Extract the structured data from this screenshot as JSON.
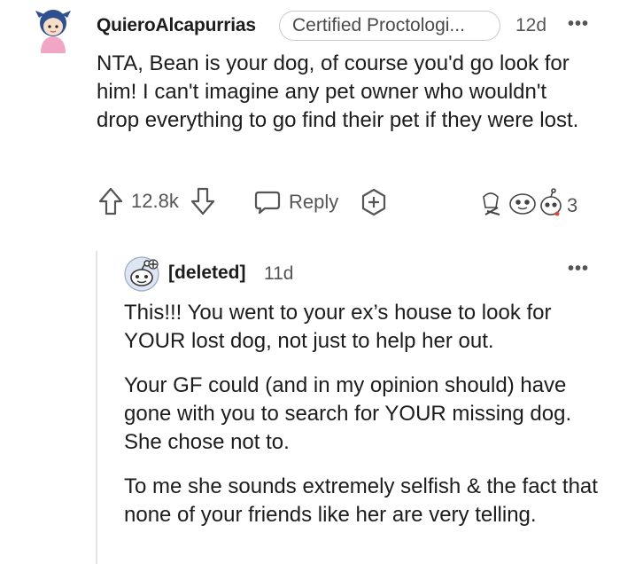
{
  "comment": {
    "username": "QuieroAlcapurrias",
    "flair": "Certified Proctologi...",
    "time": "12d",
    "more_label": "•••",
    "body": "NTA, Bean is your dog, of course you'd go look for him! I can't imagine any pet owner who wouldn't drop everything to go find their pet if they were lost.",
    "upvotes": "12.8k",
    "reply_label": "Reply",
    "award_count": "3"
  },
  "reply": {
    "username": "[deleted]",
    "time": "11d",
    "more_label": "•••",
    "paragraphs": [
      "This!!! You went to your ex’s house to look for YOUR lost dog, not just to help her out.",
      "Your GF could (and in my opinion should) have gone with you to search for YOUR missing dog. She chose not to.",
      "To me she sounds extremely selfish & the fact that none of your friends like her are very telling."
    ]
  },
  "colors": {
    "text": "#1c1c1c",
    "meta": "#555555",
    "thread_line": "#e3e3e3",
    "avatar_hair": "#2f4f8f",
    "avatar_shirt": "#f2a6c6"
  }
}
